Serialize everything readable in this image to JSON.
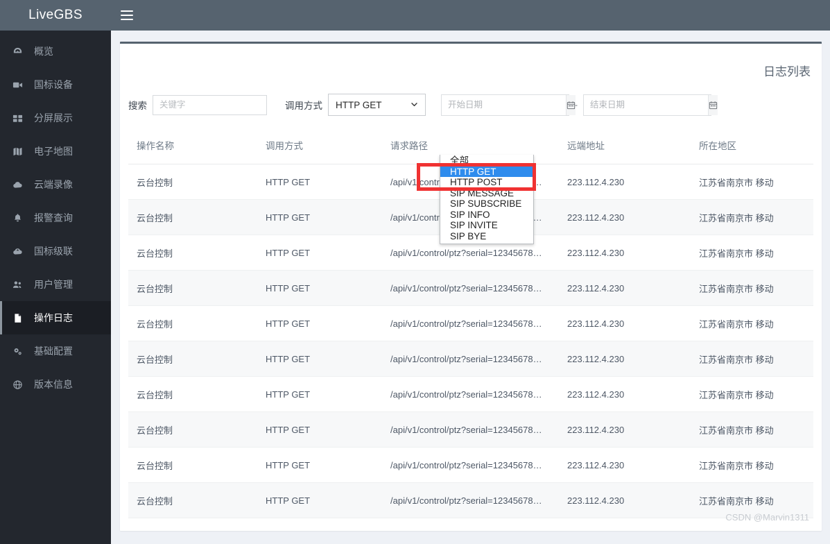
{
  "brand": {
    "title": "LiveGBS"
  },
  "topbar": {
    "menu_icon": "hamburger-icon"
  },
  "sidebar": {
    "items": [
      {
        "label": "概览",
        "icon": "dashboard-icon",
        "active": false
      },
      {
        "label": "国标设备",
        "icon": "video-camera-icon",
        "active": false
      },
      {
        "label": "分屏展示",
        "icon": "grid-icon",
        "active": false
      },
      {
        "label": "电子地图",
        "icon": "map-icon",
        "active": false
      },
      {
        "label": "云端录像",
        "icon": "cloud-icon",
        "active": false
      },
      {
        "label": "报警查询",
        "icon": "bell-icon",
        "active": false
      },
      {
        "label": "国标级联",
        "icon": "cloud-upload-icon",
        "active": false
      },
      {
        "label": "用户管理",
        "icon": "users-icon",
        "active": false
      },
      {
        "label": "操作日志",
        "icon": "document-icon",
        "active": true
      },
      {
        "label": "基础配置",
        "icon": "cogs-icon",
        "active": false
      },
      {
        "label": "版本信息",
        "icon": "globe-icon",
        "active": false
      }
    ]
  },
  "page": {
    "title": "日志列表"
  },
  "filters": {
    "search_label": "搜索",
    "search_placeholder": "关键字",
    "search_value": "",
    "method_label": "调用方式",
    "method_selected": "HTTP GET",
    "method_options": [
      "全部",
      "HTTP GET",
      "HTTP POST",
      "SIP MESSAGE",
      "SIP SUBSCRIBE",
      "SIP INFO",
      "SIP INVITE",
      "SIP BYE"
    ],
    "method_highlighted": "HTTP GET",
    "start_date_placeholder": "开始日期",
    "start_date_value": "",
    "end_date_placeholder": "结束日期",
    "end_date_value": "",
    "date_separator": "-",
    "calendar_icon": "calendar-icon",
    "chevron_icon": "chevron-down-icon"
  },
  "table": {
    "columns": [
      "操作名称",
      "调用方式",
      "请求路径",
      "远端地址",
      "所在地区"
    ],
    "rows": [
      {
        "name": "云台控制",
        "method": "HTTP GET",
        "path": "/api/v1/control/ptz?serial=12345678…",
        "remote": "223.112.4.230",
        "region": "江苏省南京市 移动"
      },
      {
        "name": "云台控制",
        "method": "HTTP GET",
        "path": "/api/v1/control/ptz?serial=12345678…",
        "remote": "223.112.4.230",
        "region": "江苏省南京市 移动"
      },
      {
        "name": "云台控制",
        "method": "HTTP GET",
        "path": "/api/v1/control/ptz?serial=12345678…",
        "remote": "223.112.4.230",
        "region": "江苏省南京市 移动"
      },
      {
        "name": "云台控制",
        "method": "HTTP GET",
        "path": "/api/v1/control/ptz?serial=12345678…",
        "remote": "223.112.4.230",
        "region": "江苏省南京市 移动"
      },
      {
        "name": "云台控制",
        "method": "HTTP GET",
        "path": "/api/v1/control/ptz?serial=12345678…",
        "remote": "223.112.4.230",
        "region": "江苏省南京市 移动"
      },
      {
        "name": "云台控制",
        "method": "HTTP GET",
        "path": "/api/v1/control/ptz?serial=12345678…",
        "remote": "223.112.4.230",
        "region": "江苏省南京市 移动"
      },
      {
        "name": "云台控制",
        "method": "HTTP GET",
        "path": "/api/v1/control/ptz?serial=12345678…",
        "remote": "223.112.4.230",
        "region": "江苏省南京市 移动"
      },
      {
        "name": "云台控制",
        "method": "HTTP GET",
        "path": "/api/v1/control/ptz?serial=12345678…",
        "remote": "223.112.4.230",
        "region": "江苏省南京市 移动"
      },
      {
        "name": "云台控制",
        "method": "HTTP GET",
        "path": "/api/v1/control/ptz?serial=12345678…",
        "remote": "223.112.4.230",
        "region": "江苏省南京市 移动"
      },
      {
        "name": "云台控制",
        "method": "HTTP GET",
        "path": "/api/v1/control/ptz?serial=12345678…",
        "remote": "223.112.4.230",
        "region": "江苏省南京市 移动"
      }
    ]
  },
  "annotation": {
    "highlight_color": "#f03232"
  },
  "watermark": {
    "text": "CSDN @Marvin1311"
  },
  "colors": {
    "sidebar_bg": "#23272e",
    "brand_bg": "#56636f",
    "topbar_bg": "#56636f",
    "page_bg": "#eef1f6",
    "accent_selected": "#2f8ced",
    "annotation_red": "#f03232"
  }
}
